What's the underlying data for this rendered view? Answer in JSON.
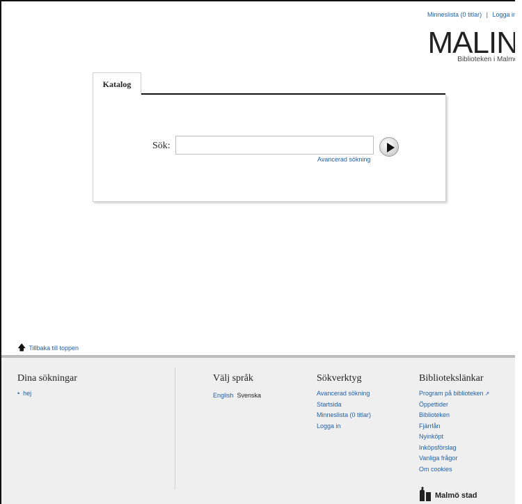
{
  "header": {
    "memory_list": "Minneslista (0 titlar)",
    "separator": "|",
    "login": "Logga in"
  },
  "logo": {
    "name": "MALIN",
    "subtitle": "Biblioteken i Malmö"
  },
  "catalog": {
    "tab_label": "Katalog",
    "search_label": "Sök:",
    "search_value": "",
    "advanced_link": "Avancerad sökning"
  },
  "back_to_top": "Tillbaka till toppen",
  "footer": {
    "searches": {
      "heading": "Dina sökningar",
      "items": [
        "hej"
      ]
    },
    "language": {
      "heading": "Välj språk",
      "english": "English",
      "swedish": "Svenska"
    },
    "tools": {
      "heading": "Sökverktyg",
      "items": [
        "Avancerad sökning",
        "Startsida",
        "Minneslista (0 titlar)",
        "Logga in"
      ]
    },
    "library_links": {
      "heading": "Bibliotekslänkar",
      "items": [
        "Program på biblioteken",
        "Öppettider",
        "Biblioteken",
        "Fjärrlån",
        "Nyinköpt",
        "Inköpsförslag",
        "Vanliga frågor",
        "Om cookies"
      ]
    },
    "city": "Malmö stad"
  },
  "colors": {
    "link": "#1f5fa8",
    "footer_bg": "#efefef"
  }
}
